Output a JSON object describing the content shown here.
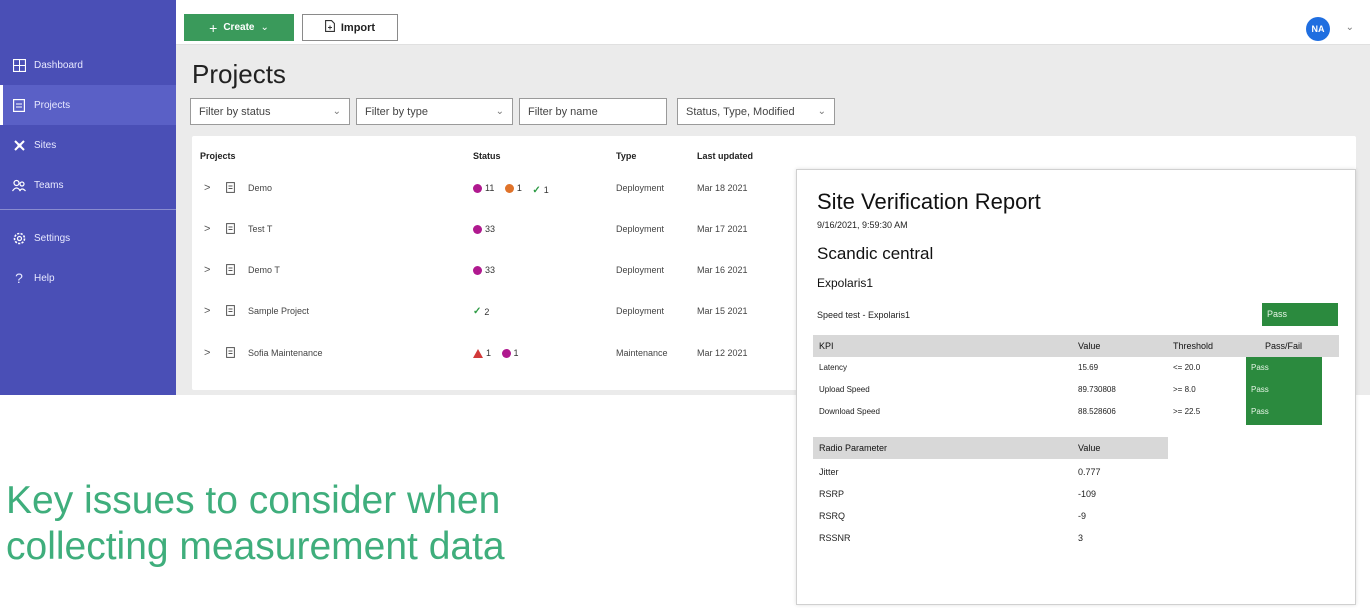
{
  "sidebar": {
    "items": [
      {
        "label": "Dashboard",
        "icon": "dashboard-icon"
      },
      {
        "label": "Projects",
        "icon": "projects-icon",
        "active": true
      },
      {
        "label": "Sites",
        "icon": "sites-icon"
      },
      {
        "label": "Teams",
        "icon": "teams-icon"
      }
    ],
    "bottom_items": [
      {
        "label": "Settings",
        "icon": "gear-icon"
      },
      {
        "label": "Help",
        "icon": "help-icon"
      }
    ]
  },
  "toolbar": {
    "create_label": "Create",
    "import_label": "Import",
    "avatar_initials": "NA"
  },
  "page": {
    "title": "Projects"
  },
  "filters": [
    {
      "label": "Filter by status"
    },
    {
      "label": "Filter by type"
    },
    {
      "placeholder": "Filter by name"
    },
    {
      "label": "Status, Type, Modified"
    }
  ],
  "table": {
    "headers": [
      "Projects",
      "Status",
      "Type",
      "Last updated"
    ],
    "rows": [
      {
        "name": "Demo",
        "type": "Deployment",
        "updated": "Mar 18 2021",
        "badges": [
          {
            "kind": "purple",
            "count": "11"
          },
          {
            "kind": "orange",
            "count": "1"
          },
          {
            "kind": "check",
            "count": "1"
          }
        ]
      },
      {
        "name": "Test T",
        "type": "Deployment",
        "updated": "Mar 17 2021",
        "badges": [
          {
            "kind": "purple",
            "count": "33"
          }
        ]
      },
      {
        "name": "Demo T",
        "type": "Deployment",
        "updated": "Mar 16 2021",
        "badges": [
          {
            "kind": "purple",
            "count": "33"
          }
        ]
      },
      {
        "name": "Sample Project",
        "type": "Deployment",
        "updated": "Mar 15 2021",
        "badges": [
          {
            "kind": "check",
            "count": "2"
          }
        ]
      },
      {
        "name": "Sofia Maintenance",
        "type": "Maintenance",
        "updated": "Mar 12 2021",
        "badges": [
          {
            "kind": "triangle",
            "count": "1"
          },
          {
            "kind": "purple",
            "count": "1"
          }
        ]
      }
    ]
  },
  "report": {
    "title": "Site Verification Report",
    "date": "9/16/2021, 9:59:30 AM",
    "site": "Scandic central",
    "device": "Expolaris1",
    "speed_test": "Speed test - Expolaris1",
    "speed_result": "Pass",
    "kpi_headers": [
      "KPI",
      "Value",
      "Threshold",
      "Pass/Fail"
    ],
    "kpi_rows": [
      {
        "kpi": "Latency",
        "value": "15.69",
        "threshold": "<= 20.0",
        "result": "Pass"
      },
      {
        "kpi": "Upload Speed",
        "value": "89.730808",
        "threshold": ">= 8.0",
        "result": "Pass"
      },
      {
        "kpi": "Download Speed",
        "value": "88.528606",
        "threshold": ">= 22.5",
        "result": "Pass"
      }
    ],
    "radio_headers": [
      "Radio Parameter",
      "Value"
    ],
    "radio_rows": [
      {
        "param": "Jitter",
        "value": "0.777"
      },
      {
        "param": "RSRP",
        "value": "-109"
      },
      {
        "param": "RSRQ",
        "value": "-9"
      },
      {
        "param": "RSSNR",
        "value": "3"
      }
    ]
  },
  "headline": {
    "line1": "Key issues to consider when",
    "line2": "collecting measurement data"
  },
  "colors": {
    "sidebar": "#4a4fb6",
    "create_button": "#3a9a5b",
    "pass": "#2b8a3e",
    "headline": "#3fae7c",
    "avatar": "#1f6ee0"
  }
}
